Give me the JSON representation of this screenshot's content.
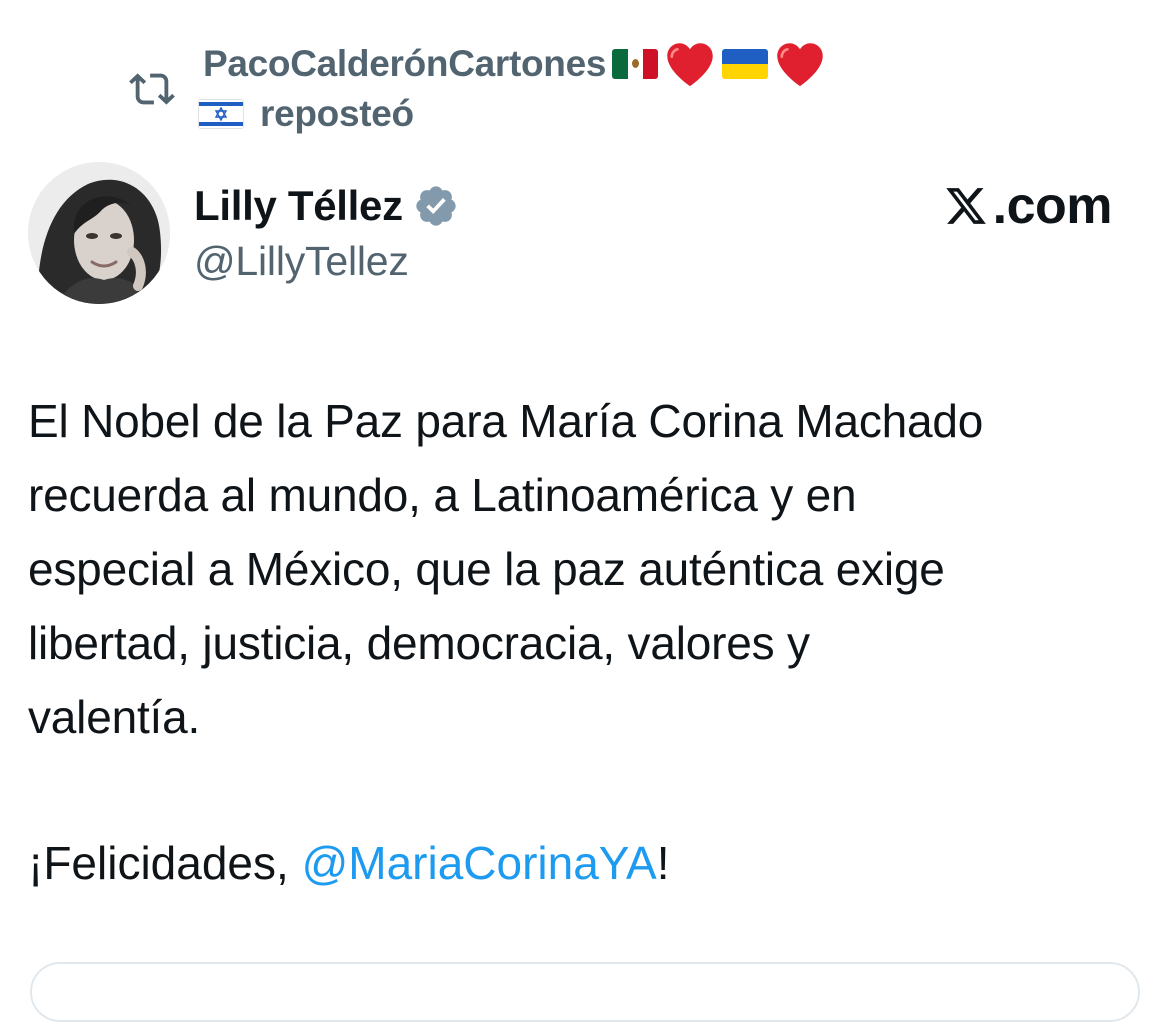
{
  "repost": {
    "icon": "repost-icon",
    "reposter_name": "PacoCalderónCartones",
    "emojis_line1": [
      "mexico-flag",
      "red-heart",
      "ukraine-flag",
      "red-heart"
    ],
    "emojis_line2": [
      "israel-flag"
    ],
    "action_text": "reposteó"
  },
  "author": {
    "avatar": "avatar",
    "display_name": "Lilly Téllez",
    "verified": true,
    "verified_color": "#829aab",
    "handle": "@LillyTellez"
  },
  "brand": {
    "logo": "x-logo",
    "suffix": ".com"
  },
  "post": {
    "lines": [
      "El Nobel de la Paz para María Corina Machado",
      "recuerda al mundo, a Latinoamérica y en",
      "especial a México, que la paz auténtica exige",
      "libertad, justicia, democracia, valores y",
      "valentía."
    ],
    "closing_prefix": "¡Felicidades, ",
    "mention": "@MariaCorinaYA",
    "closing_suffix": "!"
  },
  "colors": {
    "text_primary": "#0f1419",
    "text_secondary": "#536471",
    "link": "#1d9bf0",
    "heart": "#e0202e"
  }
}
